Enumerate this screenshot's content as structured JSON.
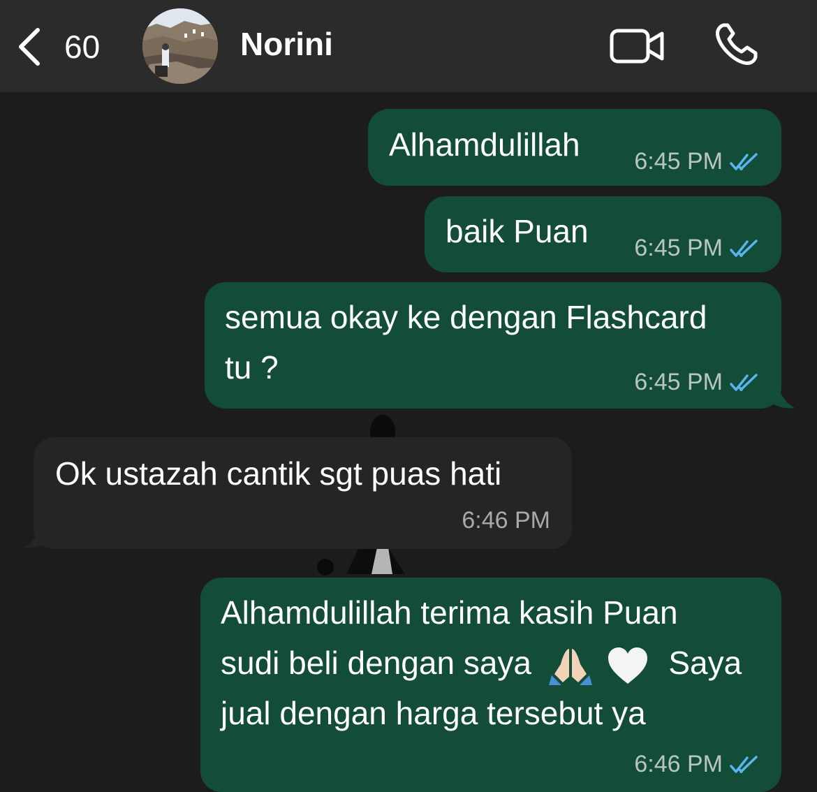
{
  "header": {
    "back_count": "60",
    "contact_name": "Norini"
  },
  "messages": [
    {
      "direction": "out",
      "text": "Alhamdulillah",
      "time": "6:45 PM",
      "status": "read"
    },
    {
      "direction": "out",
      "text": "baik Puan",
      "time": "6:45 PM",
      "status": "read"
    },
    {
      "direction": "out",
      "lines": [
        "semua okay ke dengan Flashcard",
        "tu ?"
      ],
      "time": "6:45 PM",
      "status": "read"
    },
    {
      "direction": "in",
      "text": "Ok ustazah cantik sgt puas hati",
      "time": "6:46 PM"
    },
    {
      "direction": "out",
      "lines": [
        "Alhamdulillah terima kasih Puan",
        "sudi beli dengan saya",
        "Saya",
        "jual dengan harga tersebut ya"
      ],
      "time": "6:46 PM",
      "status": "read",
      "emojis": [
        "folded-hands-icon",
        "white-heart-icon"
      ]
    }
  ],
  "colors": {
    "outgoing_bubble": "#134d37",
    "incoming_bubble": "#252525",
    "read_ticks": "#5ab4ee",
    "header_bg": "#2b2b2b",
    "chat_bg": "#1c1c1c"
  }
}
